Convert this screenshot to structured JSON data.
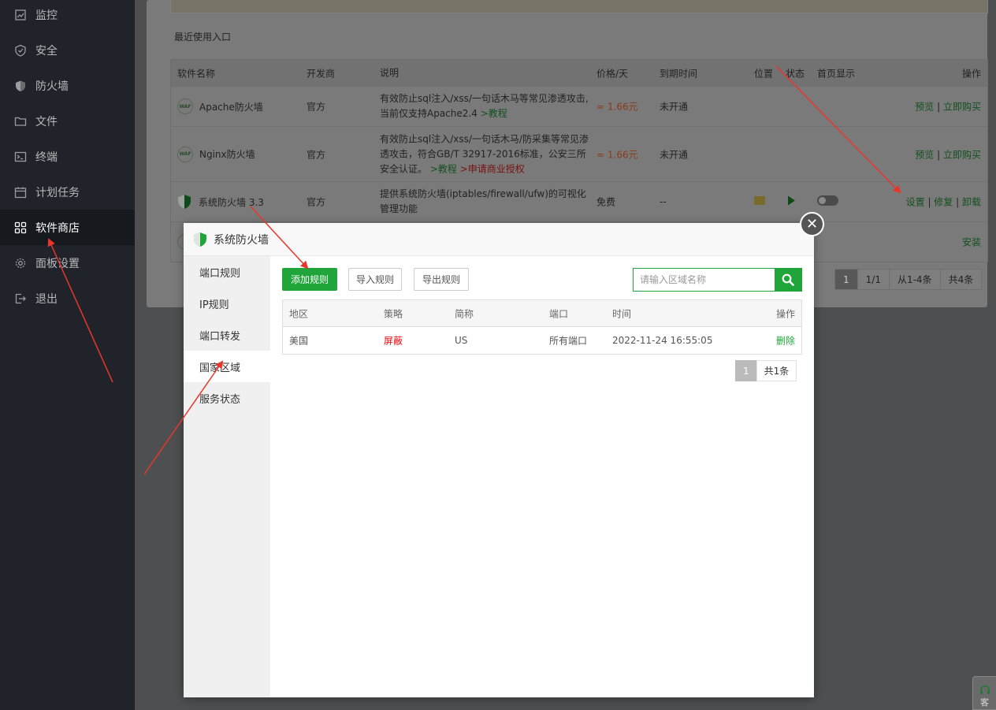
{
  "sidebar": {
    "items": [
      {
        "label": "监控",
        "icon": "monitor-icon"
      },
      {
        "label": "安全",
        "icon": "shield-icon"
      },
      {
        "label": "防火墙",
        "icon": "firewall-icon"
      },
      {
        "label": "文件",
        "icon": "folder-icon"
      },
      {
        "label": "终端",
        "icon": "terminal-icon"
      },
      {
        "label": "计划任务",
        "icon": "calendar-icon"
      },
      {
        "label": "软件商店",
        "icon": "grid-icon",
        "active": true
      },
      {
        "label": "面板设置",
        "icon": "gear-icon"
      },
      {
        "label": "退出",
        "icon": "logout-icon"
      }
    ]
  },
  "background": {
    "recent_label": "最近使用入口",
    "table": {
      "headers": [
        "软件名称",
        "开发商",
        "说明",
        "价格/天",
        "到期时间",
        "位置",
        "状态",
        "首页显示",
        "操作"
      ],
      "rows": [
        {
          "name": "Apache防火墙",
          "dev": "官方",
          "desc": "有效防止sql注入/xss/一句话木马等常见渗透攻击,当前仅支持Apache2.4",
          "desc_link": ">教程",
          "price": "≈ 1.66元",
          "expire": "未开通",
          "op_a": "预览",
          "op_b": "立即购买"
        },
        {
          "name": "Nginx防火墙",
          "dev": "官方",
          "desc": "有效防止sql注入/xss/一句话木马/防采集等常见渗透攻击，符合GB/T 32917-2016标准，公安三所安全认证。",
          "desc_link": ">教程",
          "desc_link2": ">申请商业授权",
          "price": "≈ 1.66元",
          "expire": "未开通",
          "op_a": "预览",
          "op_b": "立即购买"
        },
        {
          "name": "系统防火墙 3.3",
          "dev": "官方",
          "desc": "提供系统防火墙(iptables/firewall/ufw)的可视化管理功能",
          "price": "免费",
          "expire": "--",
          "op_a": "设置",
          "op_b": "修复",
          "op_c": "卸载"
        },
        {
          "op_a": "安装"
        }
      ]
    },
    "pager": {
      "current": "1",
      "pages": "1/1",
      "range": "从1-4条",
      "total": "共4条"
    },
    "waf_icon_text": "WAF"
  },
  "dialog": {
    "title": "系统防火墙",
    "close_glyph": "✕",
    "nav": [
      "端口规则",
      "IP规则",
      "端口转发",
      "国家区域",
      "服务状态"
    ],
    "active_nav_index": 3,
    "buttons": {
      "add": "添加规则",
      "import": "导入规则",
      "export": "导出规则"
    },
    "search": {
      "placeholder": "请输入区域名称",
      "value": ""
    },
    "table": {
      "headers": [
        "地区",
        "策略",
        "简称",
        "端口",
        "时间",
        "操作"
      ],
      "rows": [
        {
          "region": "美国",
          "policy": "屏蔽",
          "abbr": "US",
          "port": "所有端口",
          "time": "2022-11-24 16:55:05",
          "action": "删除"
        }
      ]
    },
    "pager": {
      "current": "1",
      "total": "共1条"
    }
  },
  "corner_widget": {
    "label": "客"
  },
  "colors": {
    "accent": "#20a53a",
    "danger": "#ef0808",
    "sidebar_bg": "#20242a",
    "annotation": "#e8362b"
  }
}
